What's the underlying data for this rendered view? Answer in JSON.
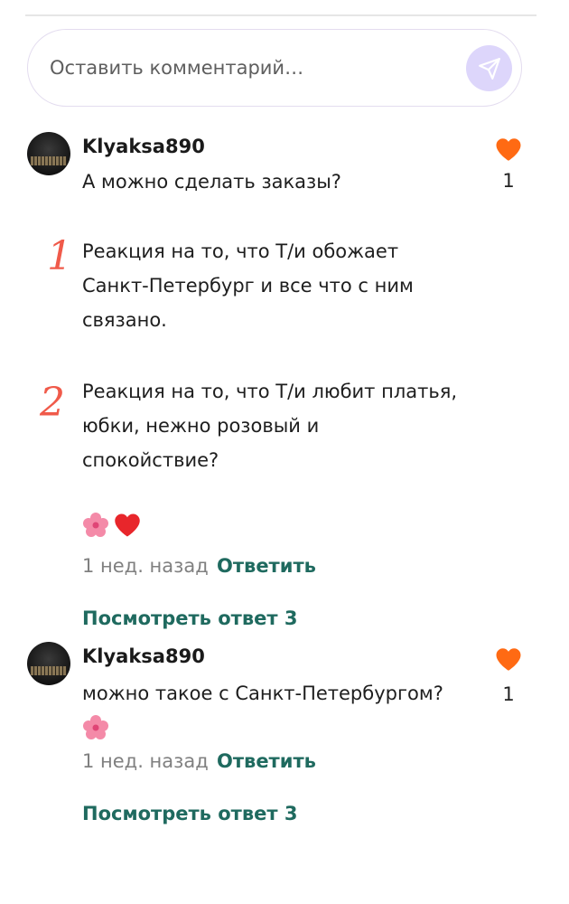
{
  "composer": {
    "placeholder": "Оставить комментарий…"
  },
  "comments": [
    {
      "username": "Klyaksa890",
      "line1": "А можно сделать заказы?",
      "item1": "Реакция на то, что Т/и обожает\nСанкт-Петербург и все что с ним\nсвязано.",
      "item2": "Реакция на то, что Т/и любит платья,\nюбки, нежно розовый и\nспокойствие?",
      "marker1": "1",
      "marker2": "2",
      "likes": "1",
      "time": "1 нед. назад",
      "reply": "Ответить",
      "view_replies": "Посмотреть ответ 3"
    },
    {
      "username": "Klyaksa890",
      "line1": "можно такое с Санкт-Петербургом?",
      "likes": "1",
      "time": "1 нед. назад",
      "reply": "Ответить",
      "view_replies": "Посмотреть ответ 3"
    }
  ],
  "colors": {
    "accent_green": "#1f6a5f",
    "like_orange": "#ff6a13",
    "send_bg": "#ddd6fb",
    "marker_red": "#f05a4a"
  },
  "icons": {
    "send": "paper-plane-icon",
    "like": "heart-icon",
    "flower": "cherry-blossom-emoji",
    "red_heart": "red-heart-emoji"
  }
}
